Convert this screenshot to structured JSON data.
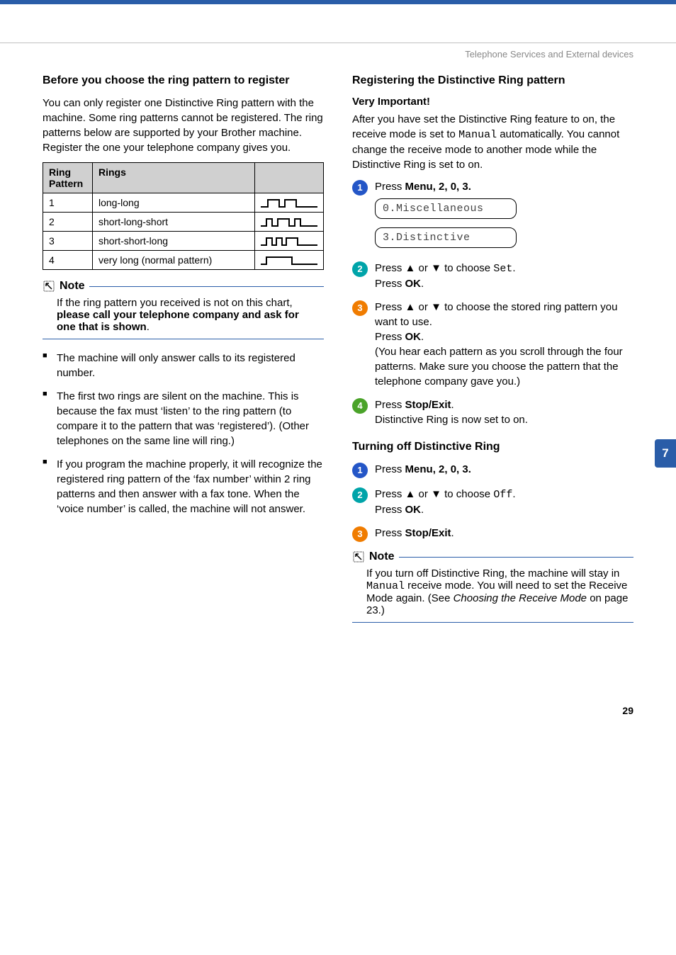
{
  "header": {
    "running": "Telephone Services and External devices"
  },
  "side_tab": "7",
  "page_number": "29",
  "left": {
    "heading1": "Before you choose the ring pattern to register",
    "intro": "You can only register one Distinctive Ring pattern with the machine. Some ring patterns cannot be registered. The ring patterns below are supported by your Brother machine. Register the one your telephone company gives you.",
    "table": {
      "col1": "Ring Pattern",
      "col2": "Rings",
      "rows": [
        {
          "n": "1",
          "desc": "long-long"
        },
        {
          "n": "2",
          "desc": "short-long-short"
        },
        {
          "n": "3",
          "desc": "short-short-long"
        },
        {
          "n": "4",
          "desc": "very long (normal pattern)"
        }
      ]
    },
    "note_label": "Note",
    "note_text_pre": "If the ring pattern you received is not on this chart, ",
    "note_text_bold": "please call your telephone company and ask for one that is shown",
    "note_text_post": ".",
    "bullets": [
      "The machine will only answer calls to its registered number.",
      "The first two rings are silent on the machine. This is because the fax must ‘listen’ to the ring pattern (to compare it to the pattern that was ‘registered’). (Other telephones on the same line will ring.)",
      "If you program the machine properly, it will recognize the registered ring pattern of the ‘fax number’ within 2 ring patterns and then answer with a fax tone. When the ‘voice number’ is called, the machine will not answer."
    ]
  },
  "right": {
    "heading1": "Registering the Distinctive Ring pattern",
    "very_important": "Very Important!",
    "intro_pre": "After you have set the Distinctive Ring feature to on, the receive mode is set to ",
    "intro_mono": "Manual",
    "intro_post": " automatically. You cannot change the receive mode to another mode while the Distinctive Ring is set to on.",
    "step1_pre": "Press ",
    "step1_bold": "Menu",
    "step1_rest": ", 2, 0, 3.",
    "lcd1": "0.Miscellaneous",
    "lcd2": "3.Distinctive",
    "step2_pre": "Press ",
    "step2_mid": " or ",
    "step2_choose": " to choose ",
    "step2_set": "Set",
    "step2_dot": ".",
    "step2_press": "Press ",
    "step2_ok": "OK",
    "step2_dot2": ".",
    "step3_pre": "Press ",
    "step3_mid": " or ",
    "step3_txt1": " to choose the stored ring pattern you want to use.",
    "step3_press": "Press ",
    "step3_ok": "OK",
    "step3_dot": ".",
    "step3_paren": "(You hear each pattern as you scroll through the four patterns. Make sure you choose the pattern that the telephone company gave you.)",
    "step4_pre": "Press ",
    "step4_bold": "Stop/Exit",
    "step4_dot": ".",
    "step4_line2": "Distinctive Ring is now set to on.",
    "heading2": "Turning off Distinctive Ring",
    "off1_pre": "Press ",
    "off1_bold": "Menu",
    "off1_rest": ", 2, 0, 3.",
    "off2_pre": "Press ",
    "off2_mid": " or ",
    "off2_choose": " to choose ",
    "off2_off": "Off",
    "off2_dot": ".",
    "off2_press": "Press ",
    "off2_ok": "OK",
    "off2_dot2": ".",
    "off3_pre": "Press ",
    "off3_bold": "Stop/Exit",
    "off3_dot": ".",
    "note_label": "Note",
    "note2_pre": "If you turn off Distinctive Ring, the machine will stay in ",
    "note2_mono": "Manual",
    "note2_mid": " receive mode. You will need to set the Receive Mode again. (See ",
    "note2_italic": "Choosing the Receive Mode",
    "note2_post": " on page 23.)"
  }
}
